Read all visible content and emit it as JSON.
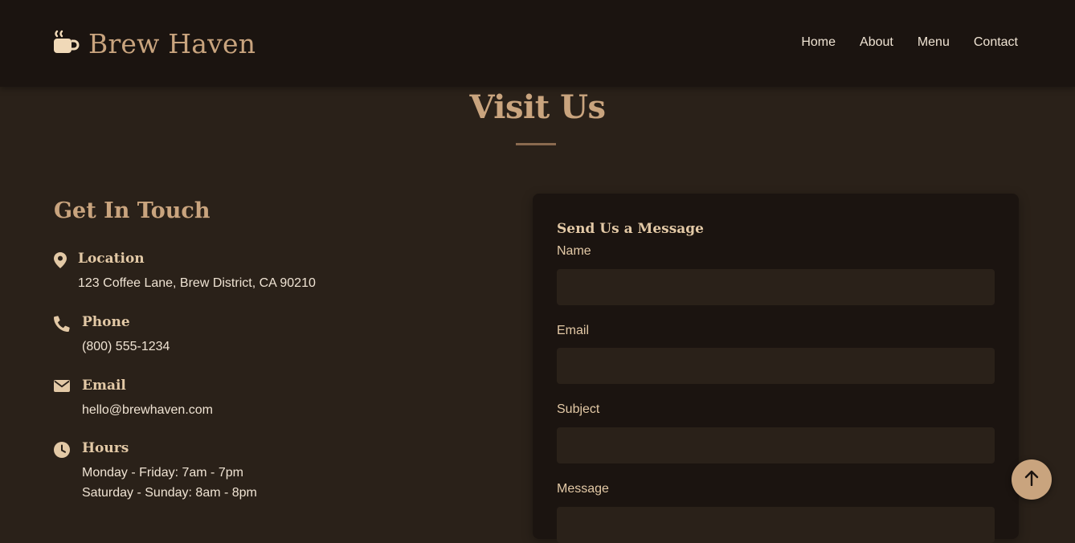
{
  "brand": {
    "name": "Brew Haven",
    "icon": "mug-hot-icon"
  },
  "nav": {
    "items": [
      "Home",
      "About",
      "Menu",
      "Contact"
    ]
  },
  "section": {
    "title": "Visit Us"
  },
  "contact": {
    "heading": "Get In Touch",
    "location": {
      "icon": "map-pin-icon",
      "title": "Location",
      "text": "123 Coffee Lane, Brew District, CA 90210"
    },
    "phone": {
      "icon": "phone-icon",
      "title": "Phone",
      "text": "(800) 555-1234"
    },
    "email": {
      "icon": "envelope-icon",
      "title": "Email",
      "text": "hello@brewhaven.com"
    },
    "hours": {
      "icon": "clock-icon",
      "title": "Hours",
      "lines": [
        "Monday - Friday: 7am - 7pm",
        "Saturday - Sunday: 8am - 8pm"
      ]
    }
  },
  "form": {
    "title": "Send Us a Message",
    "name_label": "Name",
    "name_value": "",
    "email_label": "Email",
    "email_value": "",
    "subject_label": "Subject",
    "subject_value": "",
    "message_label": "Message",
    "message_value": ""
  },
  "scroll_top": {
    "icon": "arrow-up-icon"
  },
  "colors": {
    "header_bg": "#1b1410",
    "page_bg": "#2a2119",
    "accent": "#c9a47e",
    "heading_light": "#e3c9a6",
    "text": "#efe3d3"
  }
}
